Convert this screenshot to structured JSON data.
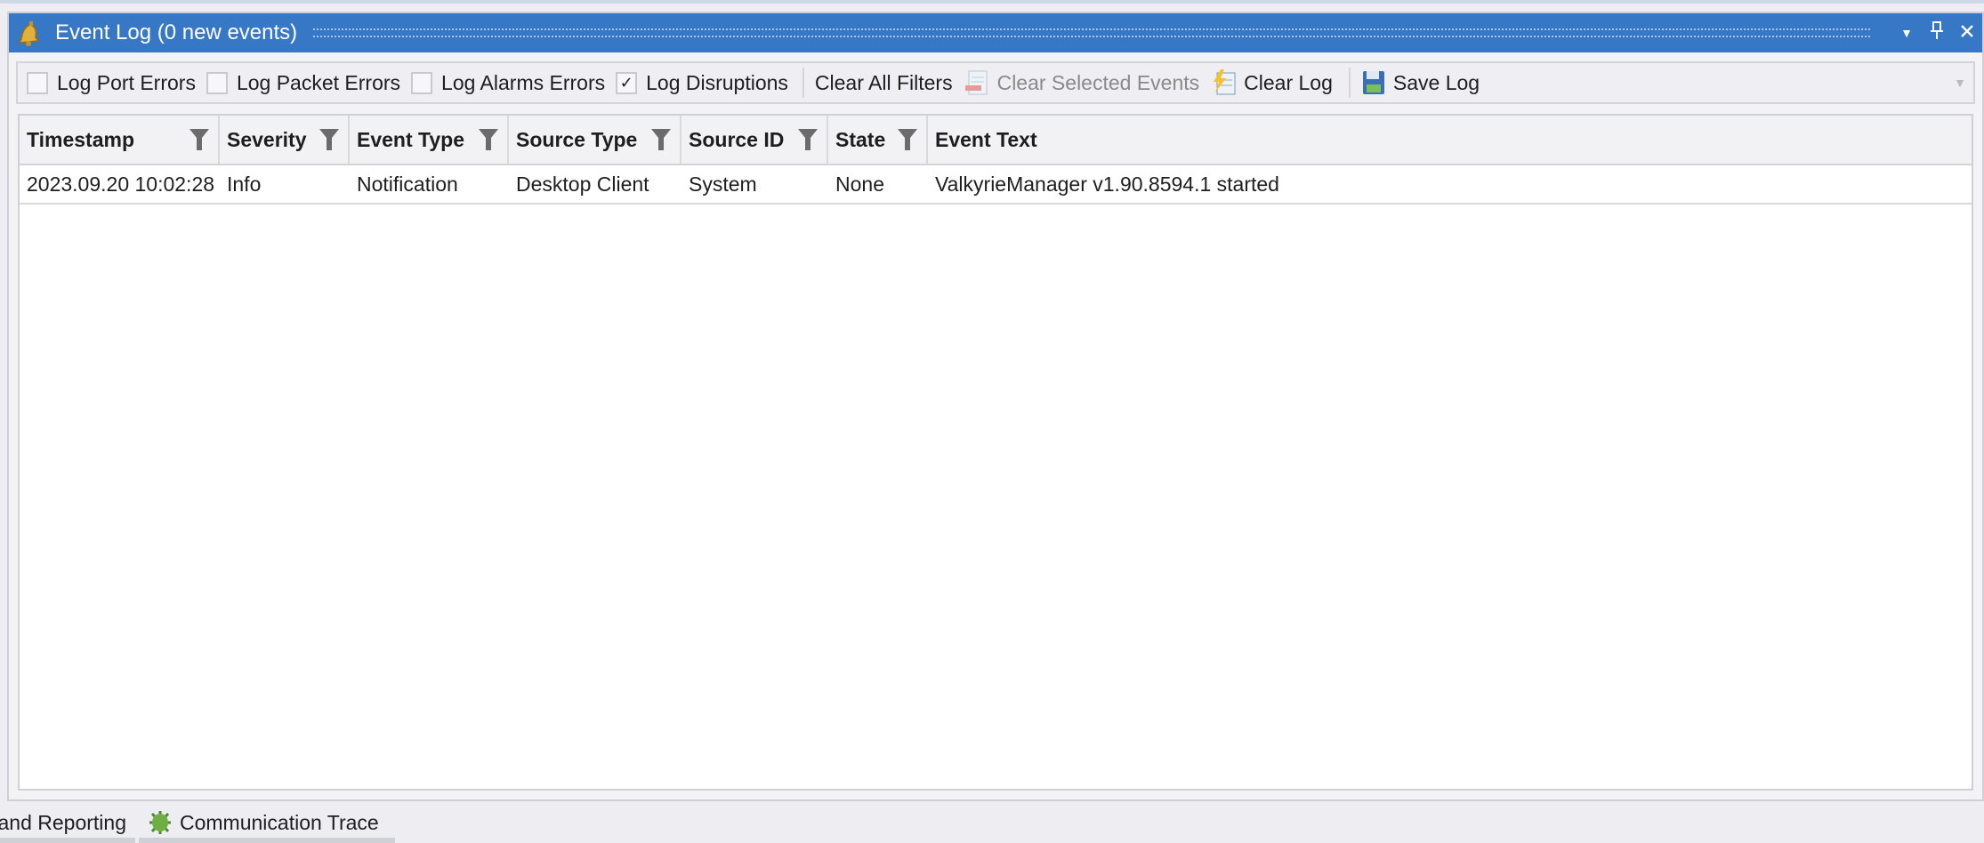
{
  "panel": {
    "title": "Event Log (0 new events)",
    "icons": [
      "bell-icon",
      "dropdown-icon",
      "pin-icon",
      "close-icon"
    ]
  },
  "toolbar": {
    "checkboxes": [
      {
        "label": "Log Port Errors",
        "checked": false
      },
      {
        "label": "Log Packet Errors",
        "checked": false
      },
      {
        "label": "Log Alarms Errors",
        "checked": false
      },
      {
        "label": "Log Disruptions",
        "checked": true,
        "mark": "✓"
      }
    ],
    "clear_filters": "Clear All Filters",
    "clear_selected": "Clear Selected Events",
    "clear_log": "Clear Log",
    "save_log": "Save Log"
  },
  "grid": {
    "columns": [
      "Timestamp",
      "Severity",
      "Event Type",
      "Source Type",
      "Source ID",
      "State",
      "Event Text"
    ],
    "rows": [
      [
        "2023.09.20 10:02:28",
        "Info",
        "Notification",
        "Desktop Client",
        "System",
        "None",
        "ValkyrieManager v1.90.8594.1 started"
      ]
    ]
  },
  "bottom_tabs": [
    {
      "label": "and Reporting"
    },
    {
      "label": "Communication Trace",
      "icon": "bug-icon"
    }
  ],
  "colors": {
    "titlebar": "#3677c6",
    "accent_green": "#5a9e3a"
  }
}
